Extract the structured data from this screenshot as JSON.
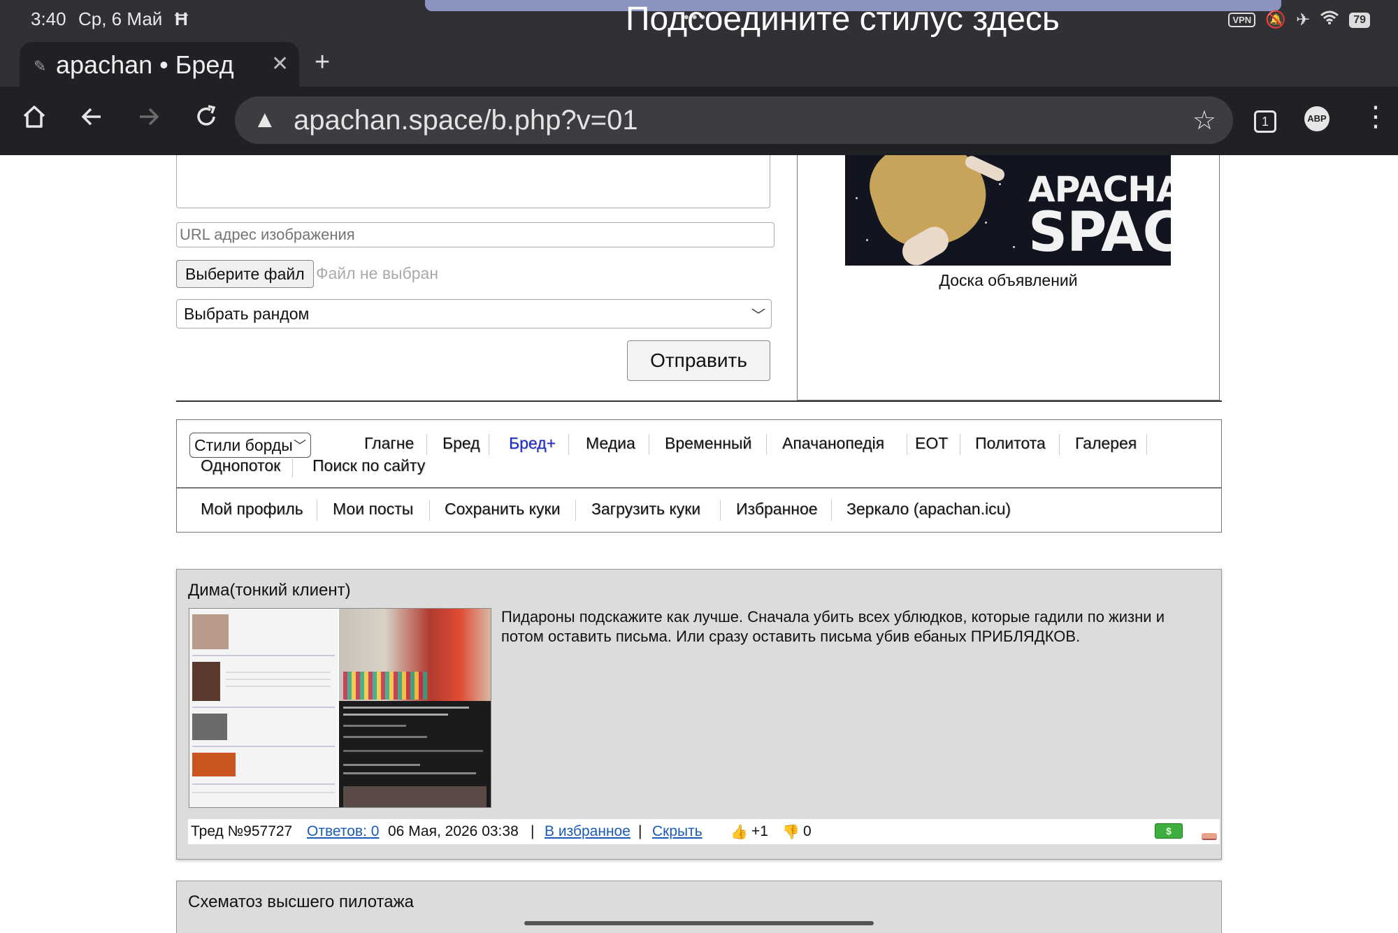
{
  "status_bar": {
    "time": "3:40",
    "date": "Ср, 6 Май",
    "extra_glyph": "Ħ",
    "vpn": "VPN",
    "battery": "79"
  },
  "tab": {
    "title": "apachan • Бред",
    "close_glyph": "✕",
    "new_tab_glyph": "+"
  },
  "stylus_hint": "Подсоедините стилус здесь",
  "toolbar": {
    "url": "apachan.space/b.php?v=01",
    "tab_count": "1",
    "adblock_label": "ABP"
  },
  "form": {
    "url_placeholder": "URL адрес изображения",
    "file_button": "Выберите файл",
    "file_status": "Файл не выбран",
    "random_select": "Выбрать рандом",
    "submit": "Отправить"
  },
  "banner": {
    "logo_line1": "APACHAN",
    "logo_line2": "SPACE",
    "caption": "Доска объявлений"
  },
  "nav": {
    "styles_select": "Стили борды",
    "links": [
      "Глагне",
      "Бред",
      "Бред+",
      "Медиа",
      "Временный",
      "Апачанопедія",
      "EOT",
      "Политота",
      "Галерея",
      "Однопоток",
      "Поиск по сайту"
    ],
    "active_link": "Бред+",
    "links2": [
      "Мой профиль",
      "Мои посты",
      "Сохранить куки",
      "Загрузить куки",
      "Избранное",
      "Зеркало (apachan.icu)"
    ]
  },
  "threads": [
    {
      "title": "Дима(тонкий клиент)",
      "text": "Пидароны подскажите как лучше. Сначала убить всех ублюдков, которые гадили по жизни и потом оставить письма. Или сразу оставить письма убив ебаных ПРИБЛЯДКОВ.",
      "thread_no": "Тред №957727",
      "replies": "Ответов: 0",
      "date": "06 Мая, 2026 03:38",
      "favorite": "В избранное",
      "hide": "Скрыть",
      "likes": "+1",
      "dislikes": "0",
      "money_glyph": "$"
    },
    {
      "title": "Схематоз высшего пилотажа"
    }
  ],
  "colors": {
    "chrome_dark": "#202124",
    "status_bar": "#2f3134",
    "active_link": "#1a27c9",
    "link": "#1a5bb8",
    "thread_bg": "#dcdcdc"
  },
  "icons": {
    "toolbar": [
      "home-icon",
      "back-icon",
      "forward-icon",
      "reload-icon",
      "warning-icon",
      "star-icon",
      "tab-switcher-icon",
      "adblock-icon",
      "menu-icon"
    ],
    "status": [
      "vpn-icon",
      "mute-icon",
      "airplane-icon",
      "wifi-icon",
      "battery-icon"
    ],
    "footer": [
      "thumbs-up-icon",
      "thumbs-down-icon",
      "money-icon",
      "eraser-icon"
    ]
  }
}
